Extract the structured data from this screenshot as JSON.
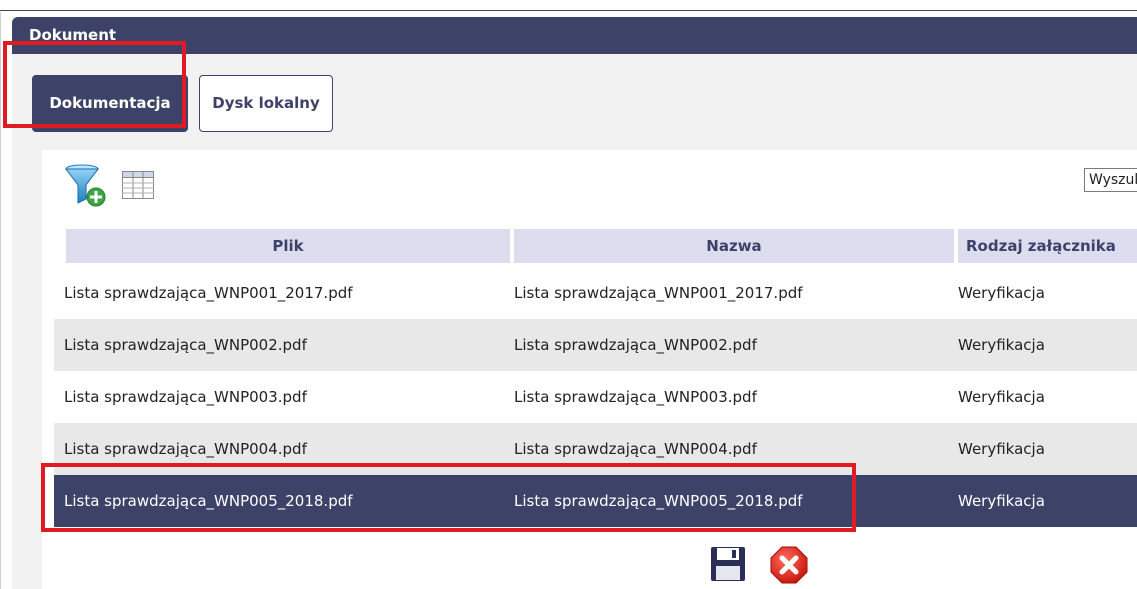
{
  "panel": {
    "title": "Dokument"
  },
  "tabs": [
    {
      "label": "Dokumentacja",
      "active": true
    },
    {
      "label": "Dysk lokalny",
      "active": false
    }
  ],
  "toolbar": {
    "filter_icon": "filter-add-icon",
    "table_icon": "table-columns-icon"
  },
  "search": {
    "label": "Wyszuk"
  },
  "table": {
    "columns": [
      "Plik",
      "Nazwa",
      "Rodzaj załącznika"
    ],
    "rows": [
      [
        "Lista sprawdzająca_WNP001_2017.pdf",
        "Lista sprawdzająca_WNP001_2017.pdf",
        "Weryfikacja"
      ],
      [
        "Lista sprawdzająca_WNP002.pdf",
        "Lista sprawdzająca_WNP002.pdf",
        "Weryfikacja"
      ],
      [
        "Lista sprawdzająca_WNP003.pdf",
        "Lista sprawdzająca_WNP003.pdf",
        "Weryfikacja"
      ],
      [
        "Lista sprawdzająca_WNP004.pdf",
        "Lista sprawdzająca_WNP004.pdf",
        "Weryfikacja"
      ],
      [
        "Lista sprawdzająca_WNP005_2018.pdf",
        "Lista sprawdzająca_WNP005_2018.pdf",
        "Weryfikacja"
      ]
    ],
    "selected_row": 4
  },
  "actions": {
    "save_icon": "save-icon",
    "close_icon": "close-icon"
  },
  "colors": {
    "header": "#3d4268",
    "highlight": "#e01b24",
    "column_header_bg": "#dcdef0",
    "row_alt_bg": "#e8e8e8"
  }
}
